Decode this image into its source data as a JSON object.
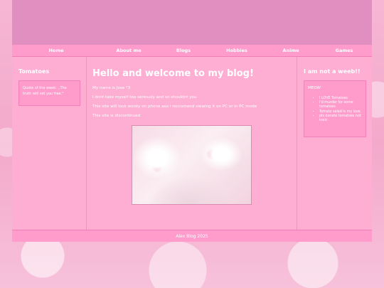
{
  "nav": {
    "items": [
      "Home",
      "About me",
      "Blogs",
      "Hobbies",
      "Anime",
      "Games"
    ]
  },
  "left": {
    "title": "Tomatoes",
    "quote": "Quote of the week: ,,The truth will set you free.\""
  },
  "main": {
    "heading": "Hello and welcome to my blog!",
    "paragraphs": [
      "My name is Jose °3",
      "I dont take myself too seriously and so shouldnt you",
      "This site will look wonky on phone aso I reccomend viewing it on PC or in PC mode",
      "This site is discontinued"
    ]
  },
  "right": {
    "title": "I am not a weeb!!",
    "box_title": "MEOW",
    "items": [
      "I LOVE Tomatoes",
      "I'd murder for some tomatoes",
      "Tomato salad is my love",
      "pls donate tomatoes not toxic"
    ]
  },
  "footer": {
    "text": "Alex Blog 2025"
  },
  "colors": {
    "banner": "#e18fc0",
    "nav": "#ff9ccc",
    "content": "#ffaed3",
    "text": "#ffffff"
  }
}
